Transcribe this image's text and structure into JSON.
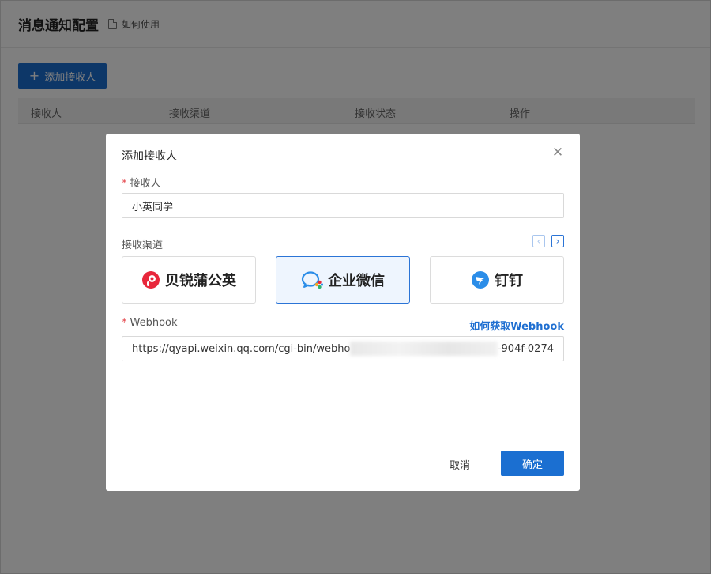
{
  "page": {
    "title": "消息通知配置",
    "help_link": "如何使用",
    "add_button": "添加接收人",
    "table_headers": [
      "接收人",
      "接收渠道",
      "接收状态",
      "操作"
    ]
  },
  "modal": {
    "title": "添加接收人",
    "close_icon": "close-icon",
    "receiver_label": "接收人",
    "receiver_value": "小英同学",
    "channel_label": "接收渠道",
    "channels": [
      {
        "name": "贝锐蒲公英",
        "icon": "pgy-logo-icon",
        "selected": false
      },
      {
        "name": "企业微信",
        "icon": "wecom-logo-icon",
        "selected": true
      },
      {
        "name": "钉钉",
        "icon": "dingtalk-logo-icon",
        "selected": false
      }
    ],
    "webhook_label": "Webhook",
    "webhook_help": "如何获取Webhook",
    "webhook_value_start": "https://qyapi.weixin.qq.com/cgi-bin/webho",
    "webhook_value_end": "-904f-0274",
    "cancel_label": "取消",
    "ok_label": "确定"
  },
  "colors": {
    "primary": "#1b6fd1",
    "required": "#e5484d",
    "selected_bg": "#eef5fe"
  }
}
